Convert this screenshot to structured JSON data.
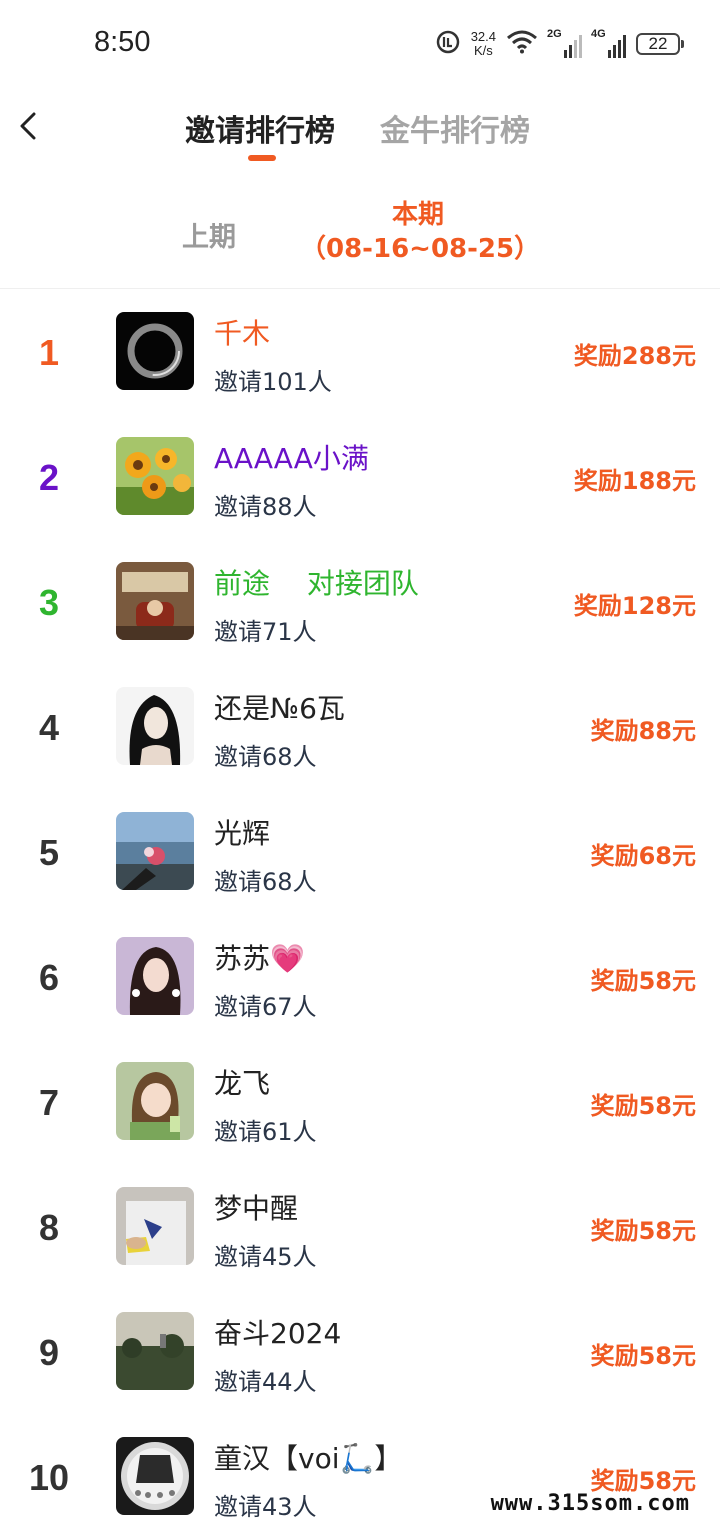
{
  "status_bar": {
    "time": "8:50",
    "net_speed_value": "32.4",
    "net_speed_unit": "K/s",
    "sig1_label": "2G",
    "sig2_label": "4G",
    "battery": "22"
  },
  "header": {
    "tabs": [
      {
        "label": "邀请排行榜",
        "active": true
      },
      {
        "label": "金牛排行榜",
        "active": false
      }
    ]
  },
  "period": {
    "previous": "上期",
    "current_title": "本期",
    "current_range": "（08-16~08-25）"
  },
  "leaderboard": [
    {
      "rank": "1",
      "name": "千木",
      "invites": "邀请101人",
      "reward": "奖励288元",
      "rank_color": "#f05a22",
      "name_color": "#f05a22"
    },
    {
      "rank": "2",
      "name": "AAAAA小满",
      "invites": "邀请88人",
      "reward": "奖励188元",
      "rank_color": "#6a12c8",
      "name_color": "#6a12c8"
    },
    {
      "rank": "3",
      "name": "前途　 对接团队",
      "invites": "邀请71人",
      "reward": "奖励128元",
      "rank_color": "#2fb52f",
      "name_color": "#2fb52f"
    },
    {
      "rank": "4",
      "name": "还是№6瓦",
      "invites": "邀请68人",
      "reward": "奖励88元"
    },
    {
      "rank": "5",
      "name": "光辉",
      "invites": "邀请68人",
      "reward": "奖励68元"
    },
    {
      "rank": "6",
      "name": "苏苏💗",
      "invites": "邀请67人",
      "reward": "奖励58元"
    },
    {
      "rank": "7",
      "name": "龙飞",
      "invites": "邀请61人",
      "reward": "奖励58元"
    },
    {
      "rank": "8",
      "name": "梦中醒",
      "invites": "邀请45人",
      "reward": "奖励58元"
    },
    {
      "rank": "9",
      "name": "奋斗2024",
      "invites": "邀请44人",
      "reward": "奖励58元"
    },
    {
      "rank": "10",
      "name": "童汉【voi🛴】",
      "invites": "邀请43人",
      "reward": "奖励58元"
    }
  ],
  "watermark": "www.315som.com"
}
